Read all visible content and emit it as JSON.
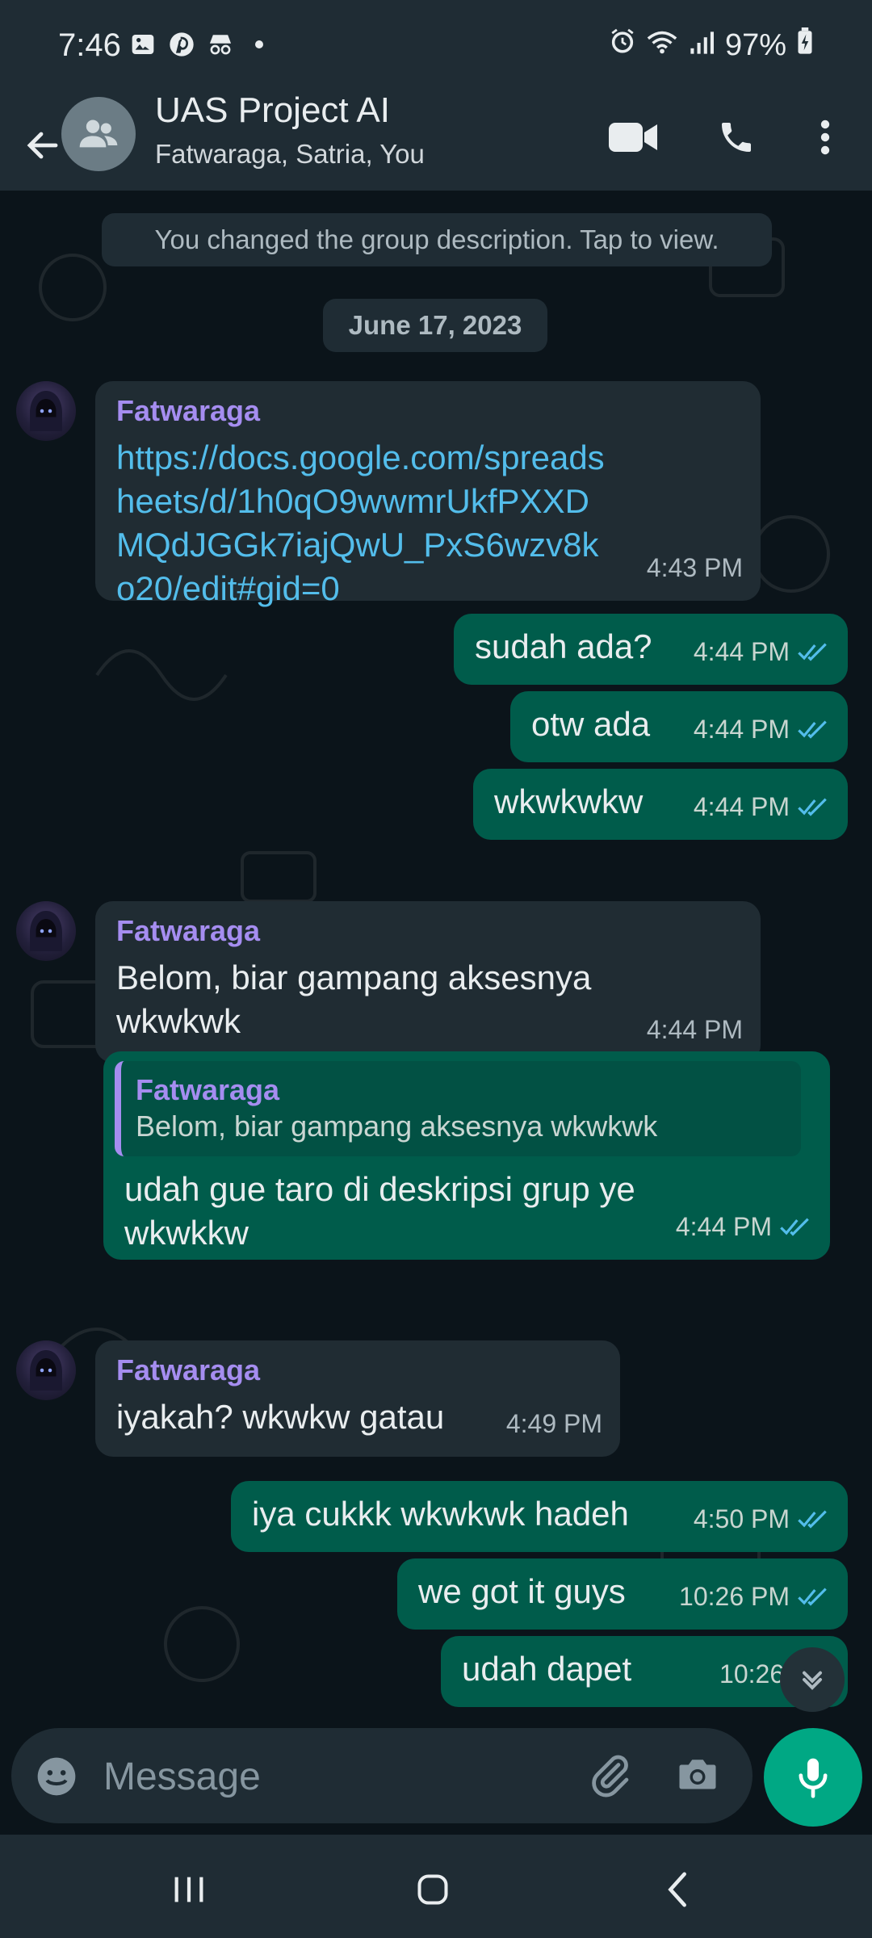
{
  "status": {
    "time": "7:46",
    "battery": "97%"
  },
  "header": {
    "title": "UAS Project AI",
    "subtitle": "Fatwaraga, Satria, You"
  },
  "chat": {
    "system_message": "You changed the group description. Tap to view.",
    "date_divider": "June 17, 2023",
    "messages": [
      {
        "type": "in",
        "sender": "Fatwaraga",
        "link": "https://docs.google.com/spreadsheets/d/1h0qO9wwmrUkfPXXDMQdJGGk7iajQwU_PxS6wzv8ko20/edit#gid=0",
        "time": "4:43 PM"
      },
      {
        "type": "out",
        "text": "sudah ada?",
        "time": "4:44 PM"
      },
      {
        "type": "out",
        "text": "otw ada",
        "time": "4:44 PM"
      },
      {
        "type": "out",
        "text": "wkwkwkw",
        "time": "4:44 PM"
      },
      {
        "type": "in",
        "sender": "Fatwaraga",
        "text": "Belom, biar gampang aksesnya wkwkwk",
        "time": "4:44 PM"
      },
      {
        "type": "out",
        "reply_to_sender": "Fatwaraga",
        "reply_to_text": "Belom, biar gampang aksesnya wkwkwk",
        "text": "udah gue taro di deskripsi grup ye wkwkkw",
        "time": "4:44 PM"
      },
      {
        "type": "in",
        "sender": "Fatwaraga",
        "text": "iyakah? wkwkw gatau",
        "time": "4:49 PM"
      },
      {
        "type": "out",
        "text": "iya cukkk wkwkwk hadeh",
        "time": "4:50 PM"
      },
      {
        "type": "out",
        "text": "we got it guys",
        "time": "10:26 PM"
      },
      {
        "type": "out",
        "text": "udah dapet",
        "time": "10:26 PM"
      }
    ]
  },
  "composer": {
    "placeholder": "Message"
  },
  "colors": {
    "accent": "#00a884",
    "outgoing_bubble": "#005c4b",
    "incoming_bubble": "#202c33",
    "sender_name": "#a58df0",
    "link": "#53bdeb",
    "read_ticks": "#53bdeb"
  },
  "icons": {
    "back": "arrow-left-icon",
    "group_avatar": "group-icon",
    "video_call": "video-camera-icon",
    "voice_call": "phone-icon",
    "menu": "more-vertical-icon",
    "emoji": "emoji-icon",
    "attach": "paperclip-icon",
    "camera": "camera-icon",
    "mic": "microphone-icon",
    "scroll_down": "chevron-double-down-icon"
  }
}
